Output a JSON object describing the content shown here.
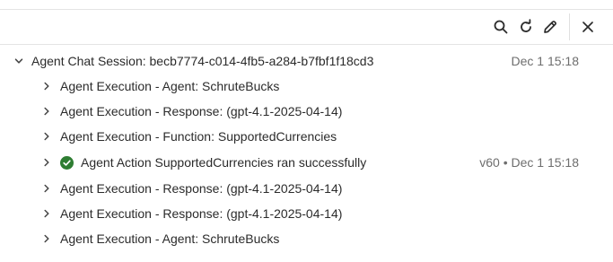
{
  "toolbar": {
    "icons": [
      "search-icon",
      "refresh-icon",
      "edit-icon",
      "close-icon"
    ]
  },
  "tree": {
    "root": {
      "label": "Agent Chat Session: becb7774-c014-4fb5-a284-b7fbf1f18cd3",
      "timestamp": "Dec 1 15:18",
      "expanded": true
    },
    "items": [
      {
        "label": "Agent Execution - Agent: SchruteBucks"
      },
      {
        "label": "Agent Execution - Response: (gpt-4.1-2025-04-14)"
      },
      {
        "label": "Agent Execution - Function: SupportedCurrencies"
      },
      {
        "label": "Agent Action SupportedCurrencies ran successfully",
        "meta": "v60 • Dec 1 15:18",
        "status": "success",
        "status_color": "#2e7d32"
      },
      {
        "label": "Agent Execution - Response: (gpt-4.1-2025-04-14)"
      },
      {
        "label": "Agent Execution - Response: (gpt-4.1-2025-04-14)"
      },
      {
        "label": "Agent Execution - Agent: SchruteBucks"
      }
    ]
  }
}
